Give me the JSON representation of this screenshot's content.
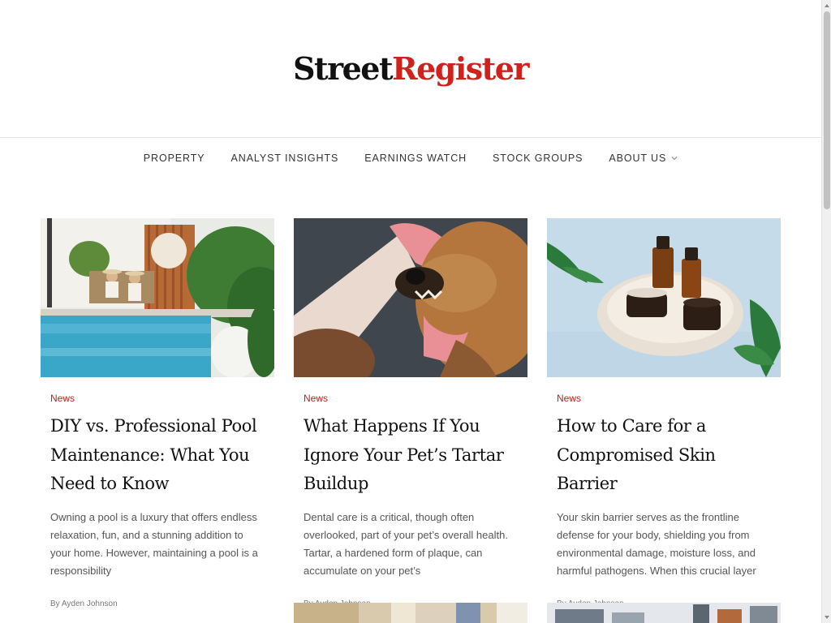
{
  "site": {
    "logo_part1": "Street",
    "logo_part2": "Register"
  },
  "nav": {
    "items": [
      {
        "label": "PROPERTY"
      },
      {
        "label": "ANALYST INSIGHTS"
      },
      {
        "label": "EARNINGS WATCH"
      },
      {
        "label": "STOCK GROUPS"
      },
      {
        "label": "ABOUT US"
      }
    ]
  },
  "articles": [
    {
      "category": "News",
      "title": "DIY vs. Professional Pool Maintenance: What You Need to Know",
      "excerpt": "Owning a pool is a luxury that offers endless relaxation, fun, and a stunning addition to your home. However, maintaining a pool is a responsibility",
      "byline": "By Ayden Johnson"
    },
    {
      "category": "News",
      "title": "What Happens If You Ignore Your Pet’s Tartar Buildup",
      "excerpt": "Dental care is a critical, though often overlooked, part of your pet’s overall health. Tartar, a hardened form of plaque, can accumulate on your pet’s",
      "byline": "By Ayden Johnson"
    },
    {
      "category": "News",
      "title": "How to Care for a Compromised Skin Barrier",
      "excerpt": "Your skin barrier serves as the frontline defense for your body, shielding you from environmental damage, moisture loss, and harmful pathogens. When this crucial layer",
      "byline": "By Ayden Johnson"
    }
  ],
  "colors": {
    "brand_black": "#111111",
    "brand_red": "#d0221d",
    "category_red": "#c41f1a"
  }
}
